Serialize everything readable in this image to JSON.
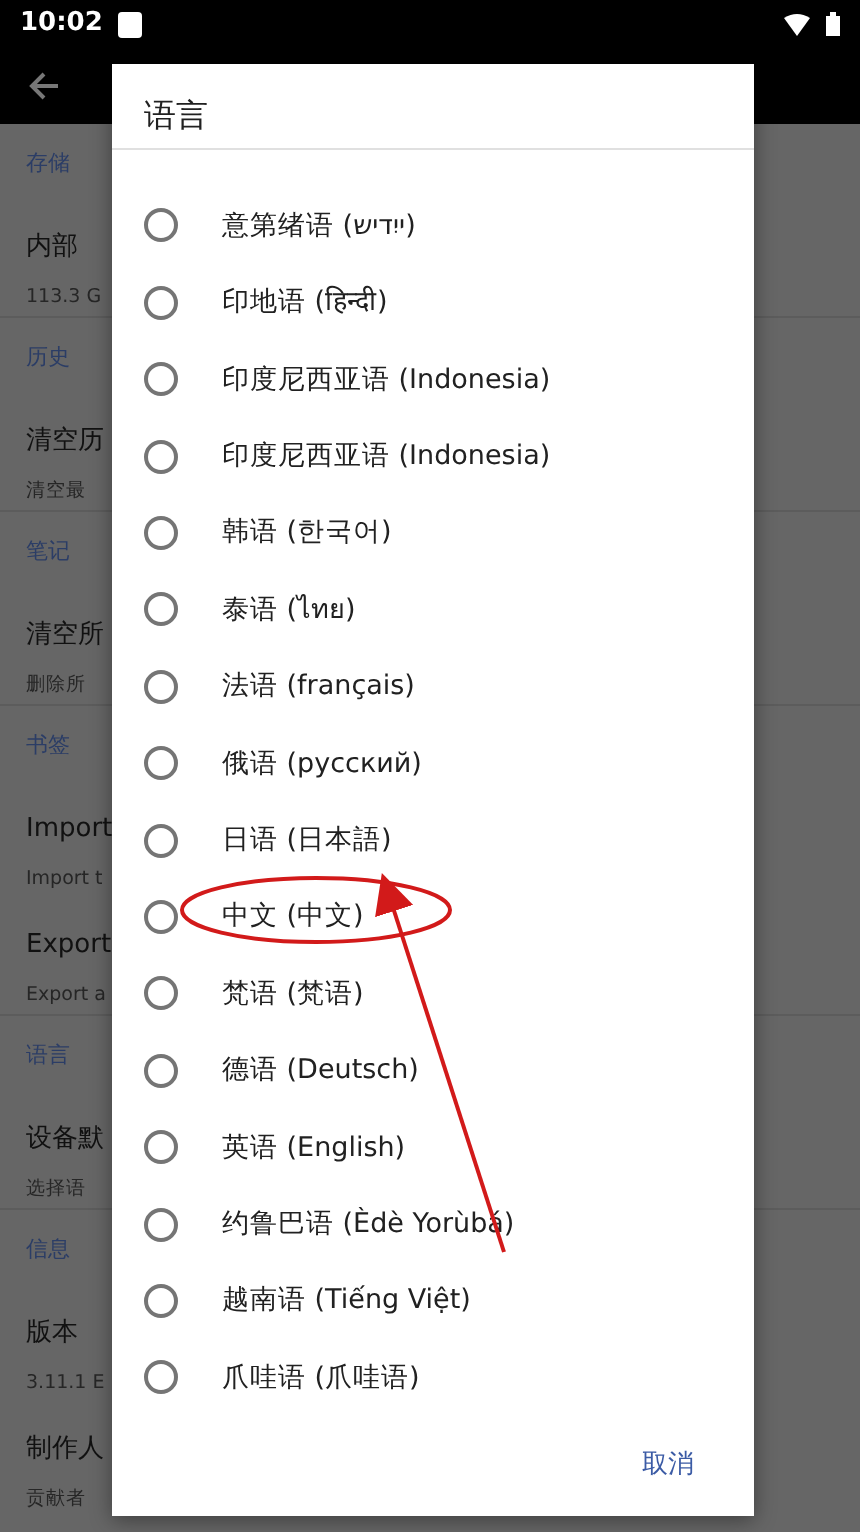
{
  "status_bar": {
    "time": "10:02"
  },
  "settings": [
    {
      "header": "存储",
      "items": [
        {
          "title": "内部",
          "subtitle": "113.3 G"
        }
      ]
    },
    {
      "header": "历史",
      "items": [
        {
          "title": "清空历",
          "subtitle": "清空最"
        }
      ]
    },
    {
      "header": "笔记",
      "items": [
        {
          "title": "清空所",
          "subtitle": "删除所"
        }
      ]
    },
    {
      "header": "书签",
      "items": [
        {
          "title": "Import",
          "subtitle": "Import t"
        },
        {
          "title": "Export",
          "subtitle": "Export a"
        }
      ]
    },
    {
      "header": "语言",
      "items": [
        {
          "title": "设备默",
          "subtitle": "选择语"
        }
      ]
    },
    {
      "header": "信息",
      "items": [
        {
          "title": "版本",
          "subtitle": "3.11.1 E"
        },
        {
          "title": "制作人",
          "subtitle": "贡献者"
        }
      ]
    }
  ],
  "dialog": {
    "title": "语言",
    "options": [
      {
        "label": "意第绪语 (ייִדיש)",
        "selected": false
      },
      {
        "label": "印地语 (हिन्दी)",
        "selected": false
      },
      {
        "label": "印度尼西亚语 (Indonesia)",
        "selected": false
      },
      {
        "label": "印度尼西亚语 (Indonesia)",
        "selected": false
      },
      {
        "label": "韩语 (한국어)",
        "selected": false
      },
      {
        "label": "泰语 (ไทย)",
        "selected": false
      },
      {
        "label": "法语 (français)",
        "selected": false
      },
      {
        "label": "俄语 (русский)",
        "selected": false
      },
      {
        "label": "日语 (日本語)",
        "selected": false
      },
      {
        "label": "中文 (中文)",
        "selected": false
      },
      {
        "label": "梵语 (梵语)",
        "selected": false
      },
      {
        "label": "德语 (Deutsch)",
        "selected": false
      },
      {
        "label": "英语 (English)",
        "selected": false
      },
      {
        "label": "约鲁巴语 (Èdè Yorùbá)",
        "selected": false
      },
      {
        "label": "越南语 (Tiếng Việt)",
        "selected": false
      },
      {
        "label": "爪哇语 (爪哇语)",
        "selected": false
      }
    ],
    "cancel": "取消"
  }
}
